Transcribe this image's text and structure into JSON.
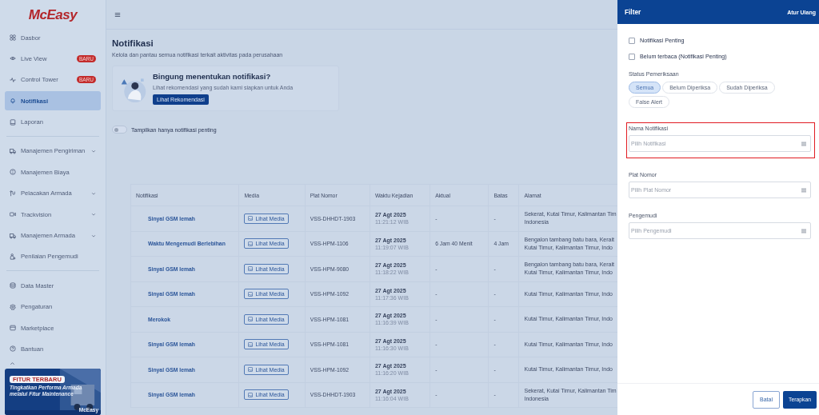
{
  "app": {
    "logo": "McEasy"
  },
  "sidebar": {
    "sections": [
      [
        {
          "label": "Dasbor",
          "expandable": false,
          "selected": false
        },
        {
          "label": "Live View",
          "badge": "BARU",
          "expandable": false,
          "selected": false
        },
        {
          "label": "Control Tower",
          "badge": "BARU",
          "expandable": false,
          "selected": false
        },
        {
          "label": "Notifikasi",
          "expandable": false,
          "selected": true
        },
        {
          "label": "Laporan",
          "expandable": false,
          "selected": false
        }
      ],
      [
        {
          "label": "Manajemen Pengiriman",
          "expandable": true,
          "selected": false
        },
        {
          "label": "Manajemen Biaya",
          "expandable": false,
          "selected": false
        },
        {
          "label": "Pelacakan Armada",
          "expandable": true,
          "selected": false
        },
        {
          "label": "Trackvision",
          "expandable": true,
          "selected": false
        },
        {
          "label": "Manajemen Armada",
          "expandable": true,
          "selected": false
        },
        {
          "label": "Penilaian Pengemudi",
          "expandable": false,
          "selected": false
        }
      ],
      [
        {
          "label": "Data Master",
          "expandable": false,
          "selected": false
        },
        {
          "label": "Pengaturan",
          "expandable": false,
          "selected": false
        },
        {
          "label": "Marketplace",
          "expandable": false,
          "selected": false
        },
        {
          "label": "Bantuan",
          "expandable": false,
          "selected": false
        }
      ]
    ]
  },
  "banner": {
    "tag": "FITUR TERBARU",
    "text": "Tingkatkan Performa Armada melalui Fitur Maintenance",
    "brand": "McEasy"
  },
  "page": {
    "title": "Notifikasi",
    "subtitle": "Kelola dan pantau semua notifikasi terkait aktivitas pada perusahaan"
  },
  "recommendation": {
    "title": "Bingung menentukan notifikasi?",
    "text": "Lihat rekomendasi yang sudah kami siapkan untuk Anda",
    "button": "Lihat Rekomendasi"
  },
  "toggle": {
    "label": "Tampilkan hanya notifikasi penting",
    "on": false
  },
  "table": {
    "columns": [
      "Notifikasi",
      "Media",
      "Plat Nomor",
      "Waktu Kejadian",
      "Aktual",
      "Batas",
      "Alamat"
    ],
    "rows": [
      {
        "notifikasi": "Sinyal GSM lemah",
        "media": "Lihat Media",
        "plat": "VSS-DHHDT-1903",
        "date": "27 Agt 2025",
        "time": "11:21:12 WIB",
        "aktual": "-",
        "batas": "-",
        "alamat": [
          "Sekerat, Kutai Timur, Kalimantan Tim",
          "Indonesia"
        ]
      },
      {
        "notifikasi": "Waktu Mengemudi Berlebihan",
        "media": "Lihat Media",
        "plat": "VSS-HPM-1106",
        "date": "27 Agt 2025",
        "time": "11:19:07 WIB",
        "aktual": "6 Jam 40 Menit",
        "batas": "4 Jam",
        "alamat": [
          "Bengalon tambang batu bara, Kerait",
          "Kutai Timur, Kalimantan Timur, Indo"
        ]
      },
      {
        "notifikasi": "Sinyal GSM lemah",
        "media": "Lihat Media",
        "plat": "VSS-HPM-9080",
        "date": "27 Agt 2025",
        "time": "11:18:22 WIB",
        "aktual": "-",
        "batas": "-",
        "alamat": [
          "Bengalon tambang batu bara, Kerait",
          "Kutai Timur, Kalimantan Timur, Indo"
        ]
      },
      {
        "notifikasi": "Sinyal GSM lemah",
        "media": "Lihat Media",
        "plat": "VSS-HPM-1092",
        "date": "27 Agt 2025",
        "time": "11:17:36 WIB",
        "aktual": "-",
        "batas": "-",
        "alamat": [
          "Kutai Timur, Kalimantan Timur, Indo"
        ]
      },
      {
        "notifikasi": "Merokok",
        "media": "Lihat Media",
        "plat": "VSS-HPM-1081",
        "date": "27 Agt 2025",
        "time": "11:16:39 WIB",
        "aktual": "-",
        "batas": "-",
        "alamat": [
          "Kutai Timur, Kalimantan Timur, Indo"
        ]
      },
      {
        "notifikasi": "Sinyal GSM lemah",
        "media": "Lihat Media",
        "plat": "VSS-HPM-1081",
        "date": "27 Agt 2025",
        "time": "11:16:30 WIB",
        "aktual": "-",
        "batas": "-",
        "alamat": [
          "Kutai Timur, Kalimantan Timur, Indo"
        ]
      },
      {
        "notifikasi": "Sinyal GSM lemah",
        "media": "Lihat Media",
        "plat": "VSS-HPM-1092",
        "date": "27 Agt 2025",
        "time": "11:16:20 WIB",
        "aktual": "-",
        "batas": "-",
        "alamat": [
          "Kutai Timur, Kalimantan Timur, Indo"
        ]
      },
      {
        "notifikasi": "Sinyal GSM lemah",
        "media": "Lihat Media",
        "plat": "VSS-DHHDT-1903",
        "date": "27 Agt 2025",
        "time": "11:16:04 WIB",
        "aktual": "-",
        "batas": "-",
        "alamat": [
          "Sekerat, Kutai Timur, Kalimantan Tim",
          "Indonesia"
        ]
      }
    ]
  },
  "filter": {
    "title": "Filter",
    "reset": "Atur Ulang",
    "checkboxes": [
      {
        "label": "Notifikasi Penting",
        "checked": false
      },
      {
        "label": "Belum terbaca (Notifikasi Penting)",
        "checked": false
      }
    ],
    "status": {
      "label": "Status Pemeriksaan",
      "options": [
        {
          "label": "Semua",
          "selected": true
        },
        {
          "label": "Belum Diperiksa",
          "selected": false
        },
        {
          "label": "Sudah Diperiksa",
          "selected": false
        },
        {
          "label": "False Alert",
          "selected": false
        }
      ]
    },
    "fields": [
      {
        "label": "Nama Notifikasi",
        "placeholder": "Pilih Notifikasi",
        "highlighted": true
      },
      {
        "label": "Plat Nomor",
        "placeholder": "Pilih Plat Nomor",
        "highlighted": false
      },
      {
        "label": "Pengemudi",
        "placeholder": "Pilih Pengemudi",
        "highlighted": false
      }
    ],
    "cancel": "Batal",
    "apply": "Terapkan"
  }
}
